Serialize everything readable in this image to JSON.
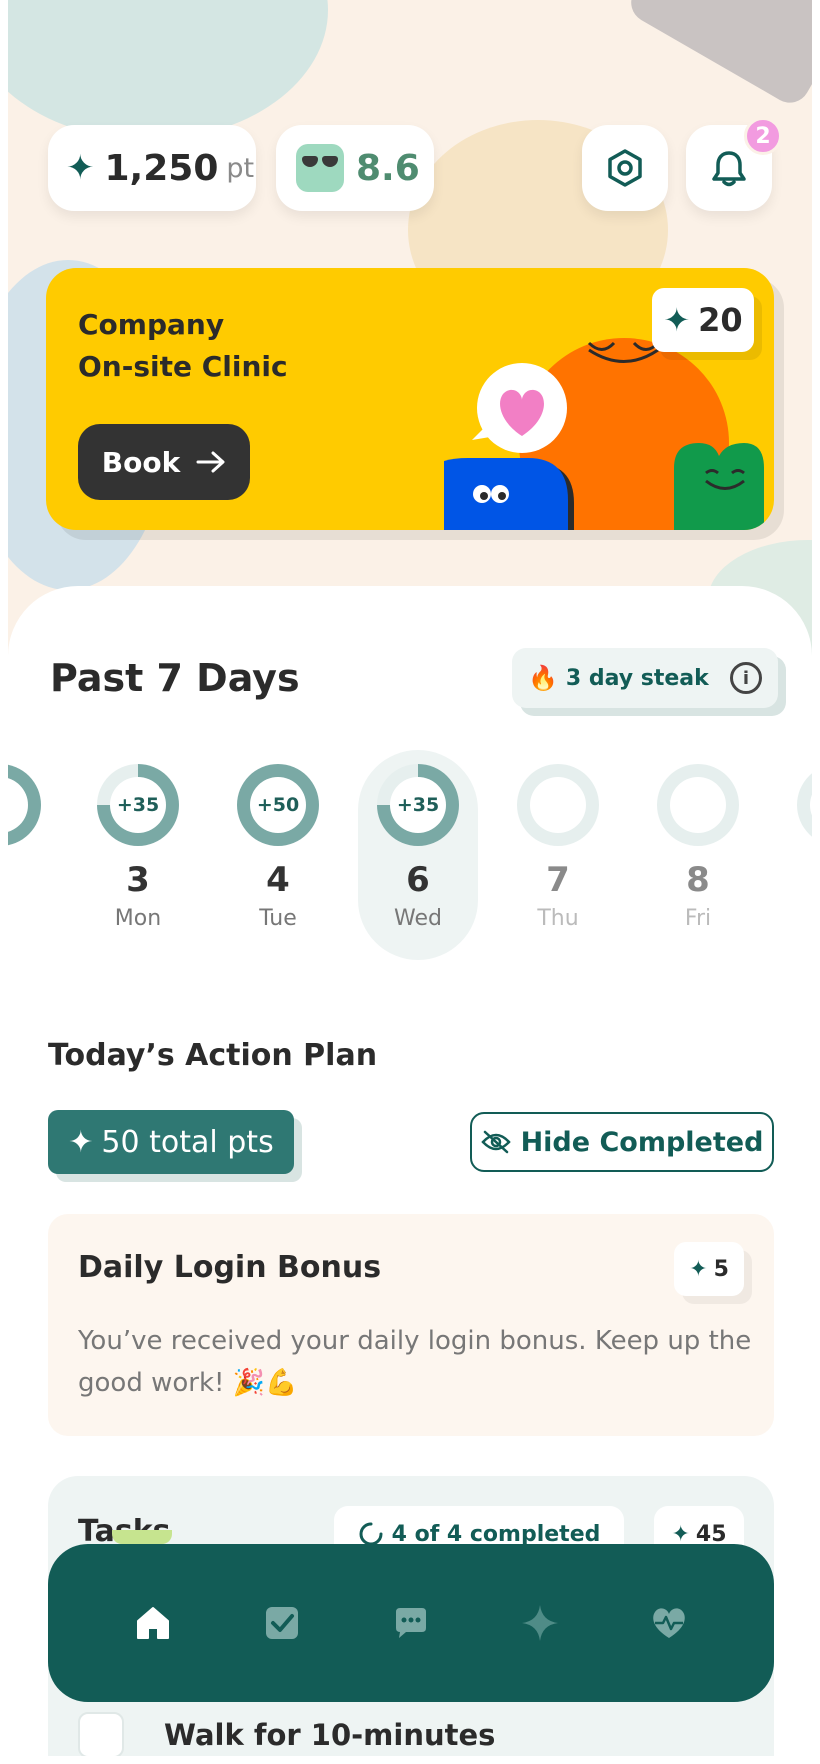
{
  "header": {
    "points_value": "1,250",
    "points_unit": "pt",
    "score_value": "8.6",
    "notification_count": "2"
  },
  "promo": {
    "title_line1": "Company",
    "title_line2": "On-site Clinic",
    "book_label": "Book",
    "points": "20"
  },
  "history": {
    "title": "Past 7 Days",
    "streak_label": "3 day steak",
    "days": [
      {
        "badge": "+35",
        "number": "3",
        "name": "Mon",
        "progress": 0.75,
        "state": "past"
      },
      {
        "badge": "+50",
        "number": "4",
        "name": "Tue",
        "progress": 1.0,
        "state": "past"
      },
      {
        "badge": "+35",
        "number": "6",
        "name": "Wed",
        "progress": 0.75,
        "state": "today"
      },
      {
        "badge": "",
        "number": "7",
        "name": "Thu",
        "progress": 0,
        "state": "future"
      },
      {
        "badge": "",
        "number": "8",
        "name": "Fri",
        "progress": 0,
        "state": "future"
      }
    ]
  },
  "action_plan": {
    "title": "Today’s Action Plan",
    "total_points": "50 total pts",
    "hide_completed_label": "Hide Completed"
  },
  "login_bonus": {
    "title": "Daily Login Bonus",
    "points": "5",
    "description": "You’ve received your daily login bonus. Keep up the good work! 🎉💪"
  },
  "tasks": {
    "title": "Tasks",
    "progress_label": "4 of 4 completed",
    "points": "45",
    "first_task": "Walk for 10-minutes"
  },
  "nav": {
    "items": [
      "home-icon",
      "tasks-check-icon",
      "chat-icon",
      "sparkle-icon",
      "heart-pulse-icon"
    ],
    "active": "home-icon"
  },
  "colors": {
    "primary": "#125c56",
    "accent_yellow": "#ffcb00",
    "orange": "#ff7300",
    "blue": "#0055e6",
    "green": "#119a4b",
    "badge_pink": "#f29be0"
  }
}
